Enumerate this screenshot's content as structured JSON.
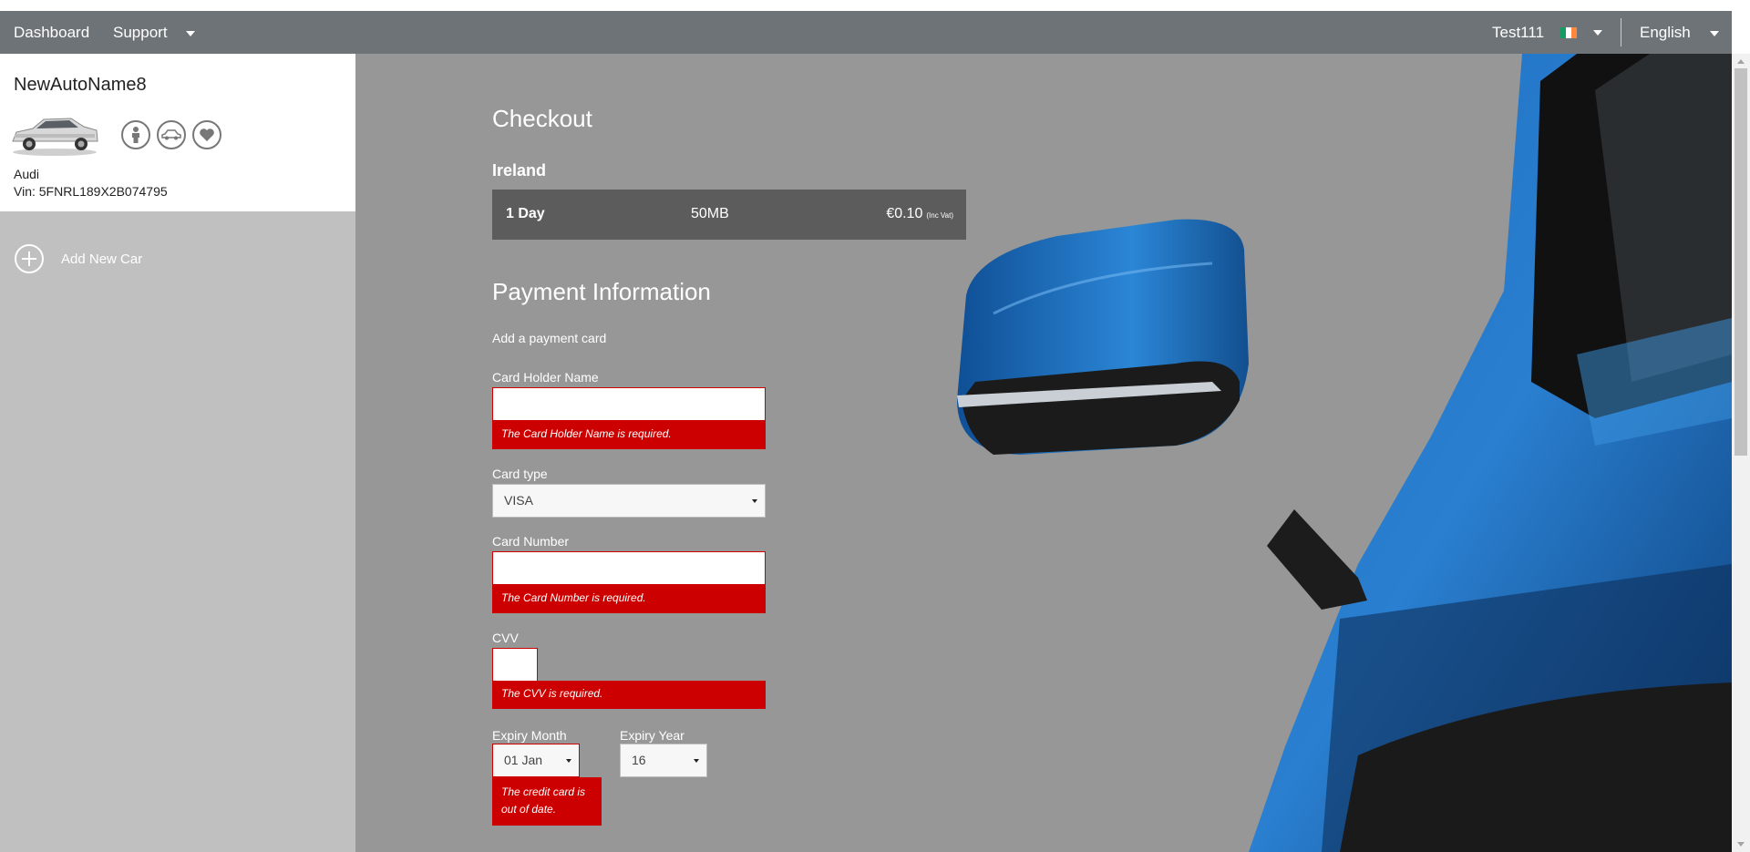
{
  "nav": {
    "dashboard": "Dashboard",
    "support": "Support",
    "user": "Test111",
    "language": "English",
    "flag_colors": [
      "#169b62",
      "#ffffff",
      "#ff883e"
    ]
  },
  "sidebar": {
    "car_name": "NewAutoName8",
    "car_make": "Audi",
    "car_vin": "Vin: 5FNRL189X2B074795",
    "icons": [
      "person-icon",
      "car-icon",
      "heart-icon"
    ],
    "add_car": "Add New Car"
  },
  "checkout": {
    "title": "Checkout",
    "country": "Ireland",
    "plan": {
      "duration": "1 Day",
      "data": "50MB",
      "price": "€0.10",
      "vat": "(Inc Vat)"
    }
  },
  "payment": {
    "title": "Payment Information",
    "subtitle": "Add a payment card",
    "card_holder_label": "Card Holder Name",
    "card_holder_value": "",
    "card_holder_error": "The Card Holder Name is required.",
    "card_type_label": "Card type",
    "card_type_value": "VISA",
    "card_number_label": "Card Number",
    "card_number_value": "",
    "card_number_error": "The Card Number is required.",
    "cvv_label": "CVV",
    "cvv_value": "",
    "cvv_error": "The CVV is required.",
    "expiry_month_label": "Expiry Month",
    "expiry_month_value": "01 Jan",
    "expiry_year_label": "Expiry Year",
    "expiry_year_value": "16",
    "expiry_error": "The credit card is out of date."
  },
  "colors": {
    "error": "#cc0000",
    "topbar": "#6d7376",
    "main_bg": "#979797",
    "plan_bar": "#5c5c5c"
  }
}
